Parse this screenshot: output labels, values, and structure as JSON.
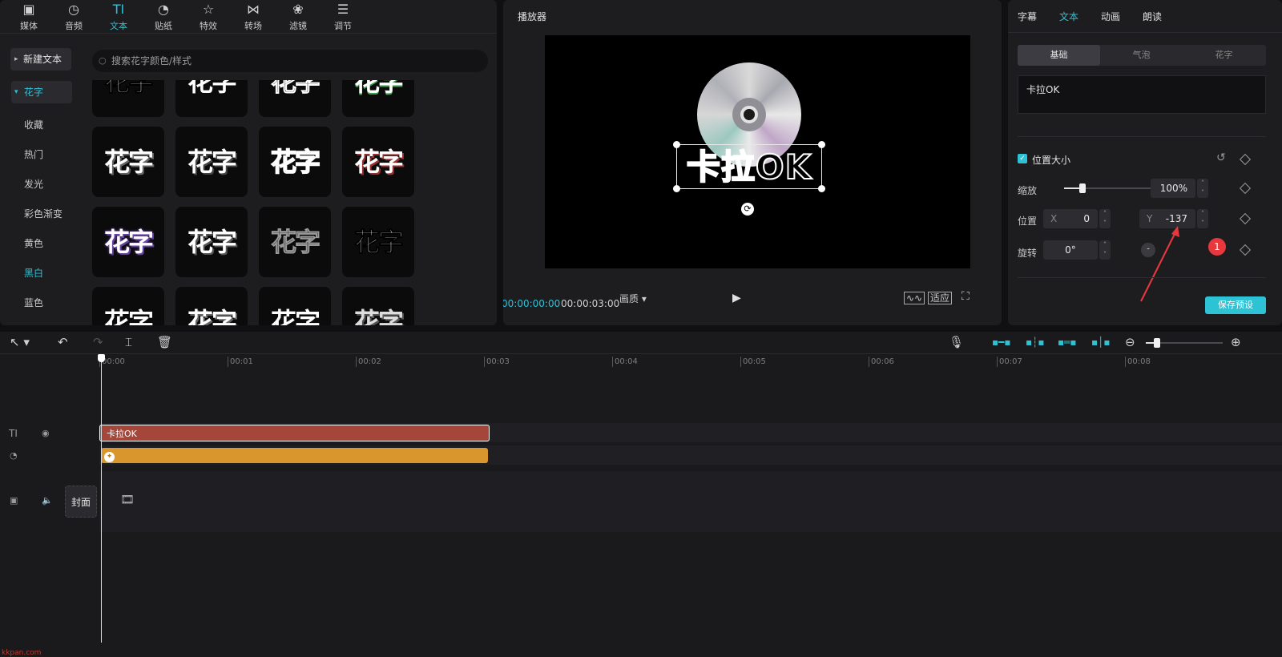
{
  "left_panel": {
    "tabs": [
      {
        "label": "媒体",
        "icon": "media-icon"
      },
      {
        "label": "音频",
        "icon": "audio-icon"
      },
      {
        "label": "文本",
        "icon": "text-icon"
      },
      {
        "label": "贴纸",
        "icon": "sticker-icon"
      },
      {
        "label": "特效",
        "icon": "effects-icon"
      },
      {
        "label": "转场",
        "icon": "transition-icon"
      },
      {
        "label": "滤镜",
        "icon": "filter-icon"
      },
      {
        "label": "调节",
        "icon": "adjust-icon"
      }
    ],
    "active_tab": "文本",
    "new_text": "新建文本",
    "category": "花字",
    "nav_items": [
      "收藏",
      "热门",
      "发光",
      "彩色渐变",
      "黄色",
      "黑白",
      "蓝色"
    ],
    "selected_nav": "黑白",
    "search_placeholder": "搜索花字颜色/样式",
    "tile_text": "花字"
  },
  "player": {
    "title": "播放器",
    "overlay_text": "卡拉OK",
    "current_time": "00:00:00:00",
    "total_time": "00:00:03:00",
    "quality": "画质",
    "fit": "适应"
  },
  "right_panel": {
    "tabs": [
      "字幕",
      "文本",
      "动画",
      "朗读"
    ],
    "active_tab": "文本",
    "segments": [
      "基础",
      "气泡",
      "花字"
    ],
    "active_segment": "基础",
    "text_value": "卡拉OK",
    "section": "位置大小",
    "scale_label": "缩放",
    "scale_value": "100%",
    "scale_fraction": 0.2,
    "position_label": "位置",
    "x_label": "X",
    "x_value": "0",
    "y_label": "Y",
    "y_value": "-137",
    "rotate_label": "旋转",
    "rotate_value": "0°",
    "save_preset": "保存预设",
    "badge": "1"
  },
  "timeline": {
    "ticks": [
      "00:00",
      "00:01",
      "00:02",
      "00:03",
      "00:04",
      "00:05",
      "00:06",
      "00:07",
      "00:08"
    ],
    "text_clip": "卡拉OK",
    "cover_label": "封面",
    "colors": {
      "text_clip": "#a4463a",
      "effect_clip": "#d9962c",
      "accent": "#2dc2d4"
    }
  },
  "watermark": "kkpan.com"
}
